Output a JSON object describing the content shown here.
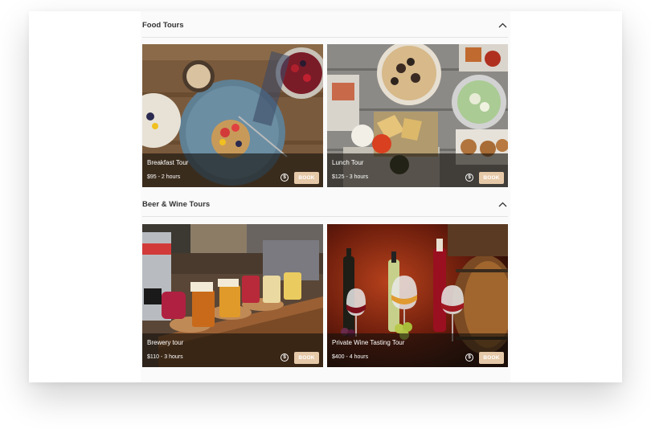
{
  "sections": [
    {
      "title": "Food Tours",
      "tours": [
        {
          "name": "Breakfast Tour",
          "meta": "$95 - 2 hours",
          "book": "BOOK",
          "price_icon": "dollar-circle-icon"
        },
        {
          "name": "Lunch Tour",
          "meta": "$125 - 3 hours",
          "book": "BOOK",
          "price_icon": "dollar-circle-icon"
        }
      ]
    },
    {
      "title": "Beer & Wine Tours",
      "tours": [
        {
          "name": "Brewery tour",
          "meta": "$110 - 3 hours",
          "book": "BOOK",
          "price_icon": "dollar-circle-icon"
        },
        {
          "name": "Private Wine Tasting Tour",
          "meta": "$400 - 4 hours",
          "book": "BOOK",
          "price_icon": "dollar-circle-icon"
        }
      ]
    }
  ],
  "colors": {
    "book_button": "#e6c9a8",
    "overlay": "#14100c"
  }
}
